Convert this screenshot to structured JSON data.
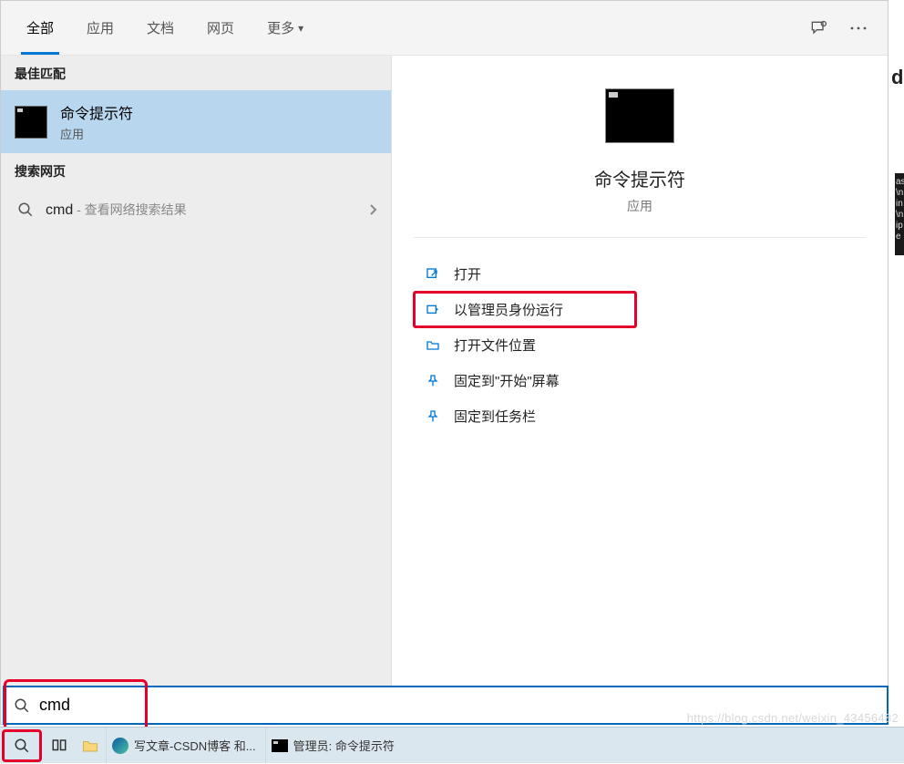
{
  "tabs": {
    "all": "全部",
    "apps": "应用",
    "docs": "文档",
    "web": "网页",
    "more": "更多"
  },
  "sections": {
    "best_match": "最佳匹配",
    "search_web": "搜索网页"
  },
  "best_match_item": {
    "title": "命令提示符",
    "subtitle": "应用"
  },
  "web_result": {
    "query": "cmd",
    "hint": " - 查看网络搜索结果"
  },
  "preview": {
    "title": "命令提示符",
    "subtitle": "应用"
  },
  "actions": {
    "open": "打开",
    "run_admin": "以管理员身份运行",
    "open_location": "打开文件位置",
    "pin_start": "固定到\"开始\"屏幕",
    "pin_taskbar": "固定到任务栏"
  },
  "search_input": {
    "value": "cmd"
  },
  "taskbar": {
    "edge_label": "写文章-CSDN博客 和...",
    "cmd_label": "管理员: 命令提示符"
  },
  "watermark": "https://blog.csdn.net/weixin_43456482",
  "side_letter": "d",
  "side_dark_text": "as\n\\n\nin\n\\n\nip\ne"
}
